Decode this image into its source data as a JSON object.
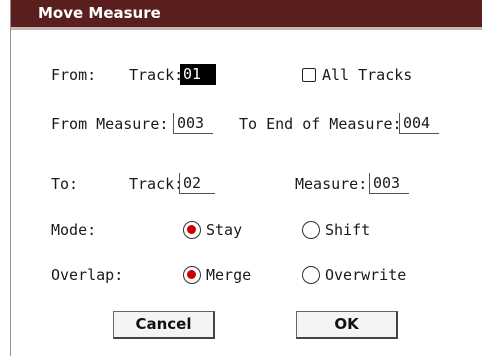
{
  "dialog": {
    "title": "Move Measure"
  },
  "from": {
    "label": "From:",
    "track_label": "Track:",
    "track_value": "01",
    "all_tracks_label": "All Tracks",
    "all_tracks_checked": false,
    "from_measure_label": "From Measure:",
    "from_measure_value": "003",
    "to_end_label": "To End of Measure:",
    "to_end_value": "004"
  },
  "to": {
    "label": "To:",
    "track_label": "Track:",
    "track_value": "02",
    "measure_label": "Measure:",
    "measure_value": "003"
  },
  "mode": {
    "label": "Mode:",
    "options": [
      "Stay",
      "Shift"
    ],
    "selected": "Stay"
  },
  "overlap": {
    "label": "Overlap:",
    "options": [
      "Merge",
      "Overwrite"
    ],
    "selected": "Merge"
  },
  "buttons": {
    "cancel": "Cancel",
    "ok": "OK"
  },
  "colors": {
    "titlebar": "#5a1e1e",
    "radio_selected": "#cc0000"
  }
}
